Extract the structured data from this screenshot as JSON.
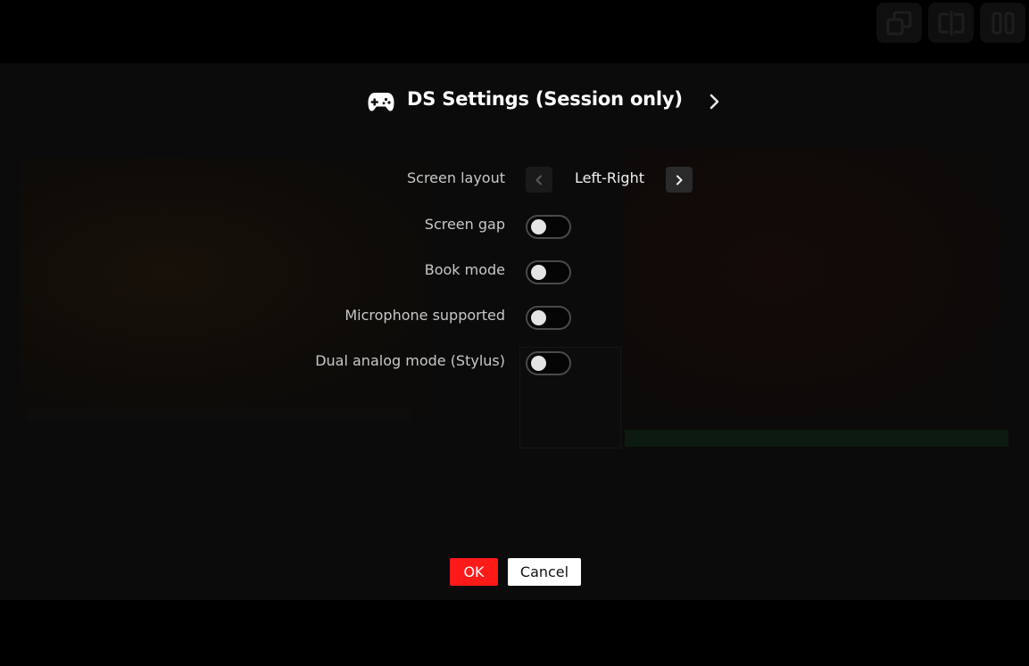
{
  "toolbar": {
    "icons": [
      "restore-windows-icon",
      "split-screen-icon",
      "pause-icon"
    ]
  },
  "dialog": {
    "title_icon": "gamepad-icon",
    "title": "DS Settings (Session only)",
    "next_icon": "chevron-right-icon",
    "settings": {
      "screen_layout": {
        "label": "Screen layout",
        "value": "Left-Right"
      },
      "screen_gap": {
        "label": "Screen gap",
        "enabled": false
      },
      "book_mode": {
        "label": "Book mode",
        "enabled": false
      },
      "microphone_supported": {
        "label": "Microphone supported",
        "enabled": false
      },
      "dual_analog_mode": {
        "label": "Dual analog mode (Stylus)",
        "enabled": false
      }
    },
    "buttons": {
      "ok_label": "OK",
      "cancel_label": "Cancel"
    }
  },
  "colors": {
    "accent": "#ff1a1a",
    "background": "#000000",
    "panel": "#0b0b0b",
    "text": "#ffffff",
    "label_text": "#c8c8c8"
  }
}
